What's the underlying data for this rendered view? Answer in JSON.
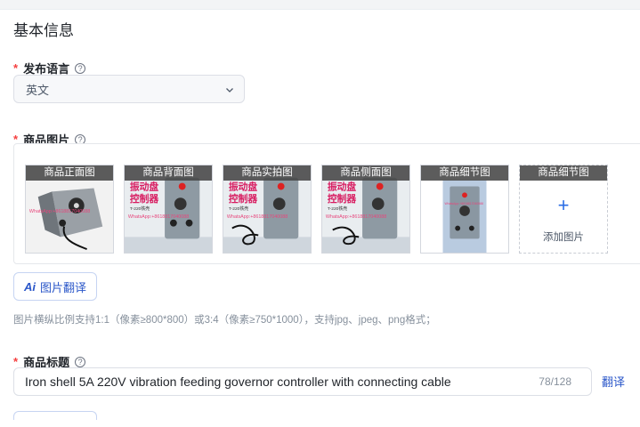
{
  "section_title": "基本信息",
  "language": {
    "label": "发布语言",
    "help": "?",
    "value": "英文"
  },
  "images": {
    "label": "商品图片",
    "help": "?",
    "items": [
      {
        "caption": "商品正面图",
        "watermark": "WhatsApp:+8618817040088"
      },
      {
        "caption": "商品背面图",
        "watermark": "WhatsApp:+8618817040088"
      },
      {
        "caption": "商品实拍图",
        "watermark": "WhatsApp:+8618817040088"
      },
      {
        "caption": "商品侧面图",
        "watermark": "WhatsApp:+8618817040088"
      },
      {
        "caption": "商品细节图",
        "watermark": "WhatsApp:+8618817040088"
      }
    ],
    "add_slot": {
      "caption": "商品细节图",
      "plus": "+",
      "text": "添加图片"
    },
    "product_text": {
      "line1": "振动盘",
      "line2": "控制器",
      "line3": "T-220铁壳"
    }
  },
  "image_translate_button": {
    "icon": "Ai",
    "label": "图片翻译"
  },
  "image_hint": "图片横纵比例支持1:1（像素≥800*800）或3:4（像素≥750*1000），支持jpg、jpeg、png格式；",
  "title_field": {
    "label": "商品标题",
    "help": "?",
    "value": "Iron shell 5A 220V vibration feeding governor controller with connecting cable",
    "counter": "78/128",
    "translate": "翻译"
  },
  "colors": {
    "required": "#f53f3f",
    "accent": "#2b57c9",
    "plus": "#2b6de5",
    "caption_bg": "#464646",
    "hint": "#86909c"
  }
}
